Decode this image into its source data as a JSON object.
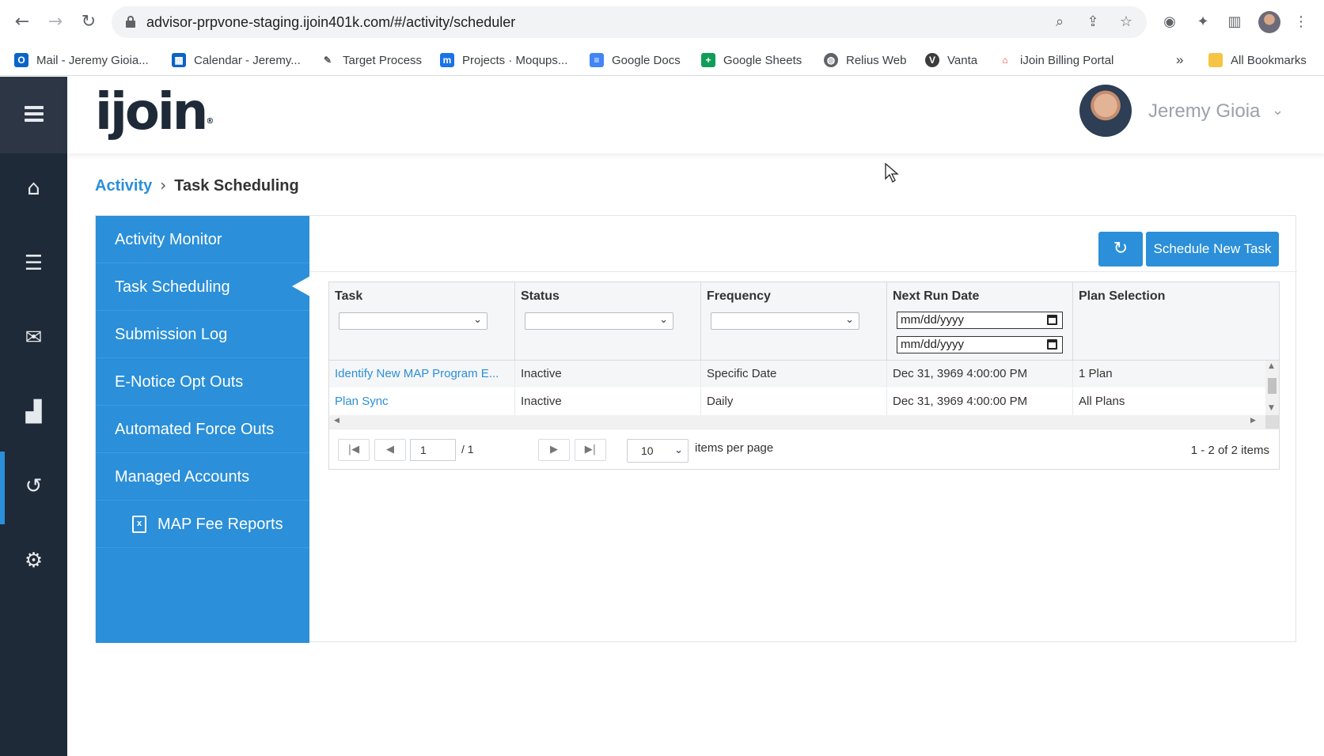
{
  "browser": {
    "url": "advisor-prpvone-staging.ijoin401k.com/#/activity/scheduler",
    "bookmarks": [
      {
        "label": "Mail - Jeremy Gioia...",
        "icon": "outlook-icon",
        "color": "#0a64c8"
      },
      {
        "label": "Calendar - Jeremy...",
        "icon": "calendar-icon",
        "color": "#0a64c8"
      },
      {
        "label": "Target Process",
        "icon": "targetprocess-icon",
        "color": "#555555"
      },
      {
        "label": "Projects · Moqups...",
        "icon": "moqups-icon",
        "color": "#1a73e8"
      },
      {
        "label": "Google Docs",
        "icon": "google-docs-icon",
        "color": "#4285f4"
      },
      {
        "label": "Google Sheets",
        "icon": "google-sheets-icon",
        "color": "#0f9d58"
      },
      {
        "label": "Relius Web",
        "icon": "globe-icon",
        "color": "#5f6368"
      },
      {
        "label": "Vanta",
        "icon": "vanta-icon",
        "color": "#3c3c3c"
      },
      {
        "label": "iJoin Billing Portal",
        "icon": "billing-portal-icon",
        "color": "#e94235"
      }
    ],
    "overflow": "»",
    "all_bookmarks": "All Bookmarks"
  },
  "app": {
    "logo_text": "ijoin",
    "logo_mark": "®",
    "user_name": "Jeremy Gioia",
    "breadcrumb": {
      "parent": "Activity",
      "separator": "›",
      "current": "Task Scheduling"
    },
    "side_menu": [
      {
        "label": "Activity Monitor"
      },
      {
        "label": "Task Scheduling"
      },
      {
        "label": "Submission Log"
      },
      {
        "label": "E-Notice Opt Outs"
      },
      {
        "label": "Automated Force Outs"
      },
      {
        "label": "Managed Accounts"
      },
      {
        "label": "MAP Fee Reports"
      }
    ],
    "buttons": {
      "refresh": "↻",
      "schedule_new": "Schedule New Task"
    },
    "grid": {
      "columns": [
        "Task",
        "Status",
        "Frequency",
        "Next Run Date",
        "Plan Selection"
      ],
      "date_placeholder": "mm/dd/yyyy",
      "rows": [
        [
          "Identify New MAP Program E...",
          "Inactive",
          "Specific Date",
          "Dec 31, 3969 4:00:00 PM",
          "1 Plan"
        ],
        [
          "Plan Sync",
          "Inactive",
          "Daily",
          "Dec 31, 3969 4:00:00 PM",
          "All Plans"
        ]
      ]
    },
    "pager": {
      "page": "1",
      "total": "/ 1",
      "per_page": "10",
      "per_page_label": "items per page",
      "summary": "1 - 2 of 2 items"
    }
  },
  "colors": {
    "accent": "#2b8fd9",
    "nav_bg": "#1f2a38"
  }
}
